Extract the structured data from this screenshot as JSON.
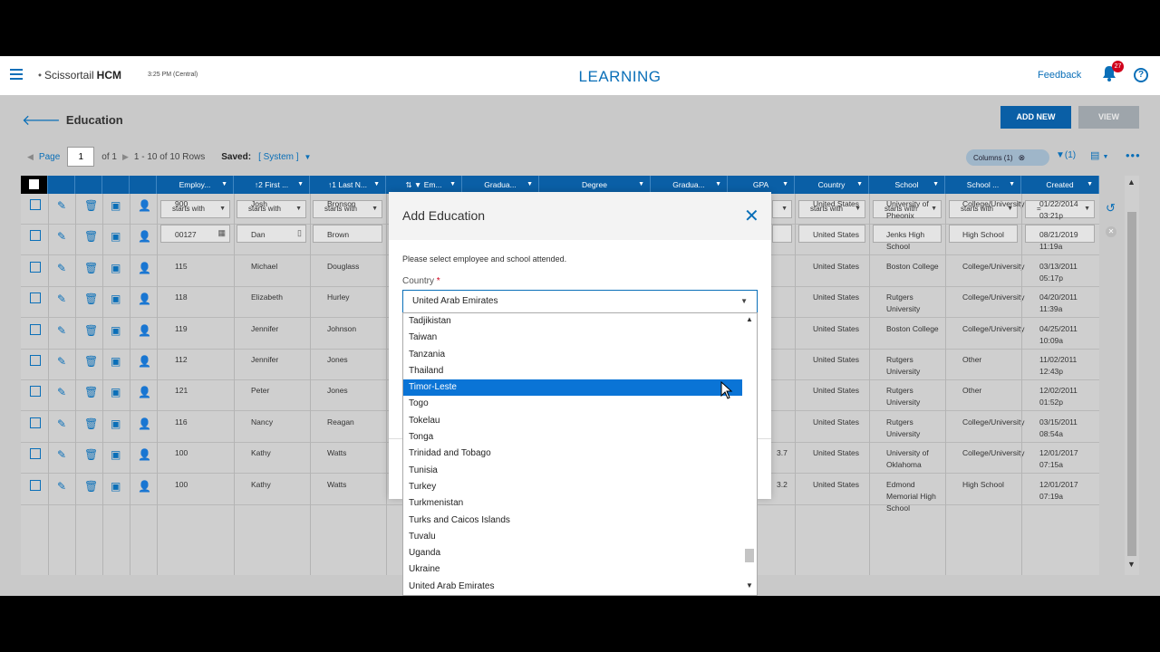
{
  "topbar": {
    "brand": "Scissortail",
    "brand_suffix": "HCM",
    "clock": "3:25 PM (Central)",
    "module": "LEARNING",
    "feedback": "Feedback",
    "notifications": "27",
    "help": "?"
  },
  "page": {
    "title": "Education",
    "add_new": "ADD NEW",
    "view": "VIEW"
  },
  "pager": {
    "page_label": "Page",
    "page_value": "1",
    "of": "of 1",
    "rows": "1 - 10 of 10 Rows",
    "saved_label": "Saved:",
    "saved_value": "[ System ]"
  },
  "toolbar": {
    "columns": "Columns (1)",
    "filter_count": "(1)"
  },
  "columns": [
    "Employ...",
    "First ...",
    "Last N...",
    "Em...",
    "Gradua...",
    "Degree",
    "Gradua...",
    "GPA",
    "Country",
    "School",
    "School ...",
    "Created"
  ],
  "column_prefix": {
    "first": "↑2",
    "last": "↑1",
    "em": "⇅ ▼"
  },
  "filters": {
    "starts_with": "starts with",
    "equals": "="
  },
  "rows": [
    {
      "emp": "900",
      "first": "Josh",
      "last": "Bronson",
      "gpa": "",
      "country": "United States",
      "school": "University of Pheonix",
      "school_type": "College/University",
      "created": "01/22/2014 03:21p"
    },
    {
      "emp": "00127",
      "first": "Dan",
      "last": "Brown",
      "gpa": "",
      "country": "United States",
      "school": "Jenks High School",
      "school_type": "High School",
      "created": "08/21/2019 11:19a"
    },
    {
      "emp": "115",
      "first": "Michael",
      "last": "Douglass",
      "gpa": "",
      "country": "United States",
      "school": "Boston College",
      "school_type": "College/University",
      "created": "03/13/2011 05:17p"
    },
    {
      "emp": "118",
      "first": "Elizabeth",
      "last": "Hurley",
      "gpa": "",
      "country": "United States",
      "school": "Rutgers University",
      "school_type": "College/University",
      "created": "04/20/2011 11:39a"
    },
    {
      "emp": "119",
      "first": "Jennifer",
      "last": "Johnson",
      "gpa": "",
      "country": "United States",
      "school": "Boston College",
      "school_type": "College/University",
      "created": "04/25/2011 10:09a"
    },
    {
      "emp": "112",
      "first": "Jennifer",
      "last": "Jones",
      "gpa": "",
      "country": "United States",
      "school": "Rutgers University",
      "school_type": "Other",
      "created": "11/02/2011 12:43p"
    },
    {
      "emp": "121",
      "first": "Peter",
      "last": "Jones",
      "gpa": "",
      "country": "United States",
      "school": "Rutgers University",
      "school_type": "Other",
      "created": "12/02/2011 01:52p"
    },
    {
      "emp": "116",
      "first": "Nancy",
      "last": "Reagan",
      "gpa": "",
      "country": "United States",
      "school": "Rutgers University",
      "school_type": "College/University",
      "created": "03/15/2011 08:54a"
    },
    {
      "emp": "100",
      "first": "Kathy",
      "last": "Watts",
      "gpa": "3.7",
      "country": "United States",
      "school": "University of Oklahoma",
      "school_type": "College/University",
      "created": "12/01/2017 07:15a"
    },
    {
      "emp": "100",
      "first": "Kathy",
      "last": "Watts",
      "gpa": "3.2",
      "country": "United States",
      "school": "Edmond Memorial High School",
      "school_type": "High School",
      "created": "12/01/2017 07:19a"
    }
  ],
  "modal": {
    "title": "Add Education",
    "description": "Please select employee and school attended.",
    "country_label": "Country",
    "required_mark": "*",
    "country_value": "United Arab Emirates"
  },
  "country_options": [
    "Tadjikistan",
    "Taiwan",
    "Tanzania",
    "Thailand",
    "Timor-Leste",
    "Togo",
    "Tokelau",
    "Tonga",
    "Trinidad and Tobago",
    "Tunisia",
    "Turkey",
    "Turkmenistan",
    "Turks and Caicos Islands",
    "Tuvalu",
    "Uganda",
    "Ukraine",
    "United Arab Emirates"
  ],
  "highlighted_option": "Timor-Leste",
  "colors": {
    "brand_blue": "#0a5fa6",
    "link_blue": "#0a6fb8",
    "highlight": "#0a74d6",
    "badge_red": "#d0021b"
  }
}
